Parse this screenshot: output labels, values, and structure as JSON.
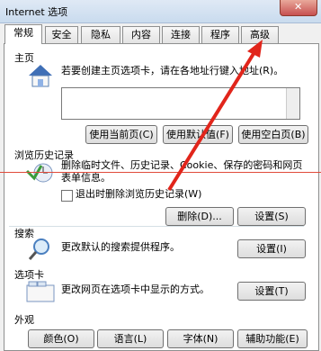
{
  "window": {
    "title": "Internet 选项"
  },
  "tabs": [
    "常规",
    "安全",
    "隐私",
    "内容",
    "连接",
    "程序",
    "高级"
  ],
  "home": {
    "title": "主页",
    "desc": "若要创建主页选项卡，请在各地址行键入地址(R)。",
    "buttons": [
      "使用当前页(C)",
      "使用默认值(F)",
      "使用空白页(B)"
    ]
  },
  "history": {
    "title": "浏览历史记录",
    "desc1": "删除临时文件、历史记录、Cookie、保存的密码和网页",
    "desc2": "表单信息。",
    "checkbox_label": "退出时删除浏览历史记录(W)",
    "delete_button": "删除(D)...",
    "settings_button": "设置(S)"
  },
  "search": {
    "title": "搜索",
    "desc": "更改默认的搜索提供程序。",
    "settings_button": "设置(I)"
  },
  "tabs_section": {
    "title": "选项卡",
    "desc": "更改网页在选项卡中显示的方式。",
    "settings_button": "设置(T)"
  },
  "appearance": {
    "title": "外观",
    "buttons": [
      "颜色(O)",
      "语言(L)",
      "字体(N)",
      "辅助功能(E)"
    ]
  }
}
